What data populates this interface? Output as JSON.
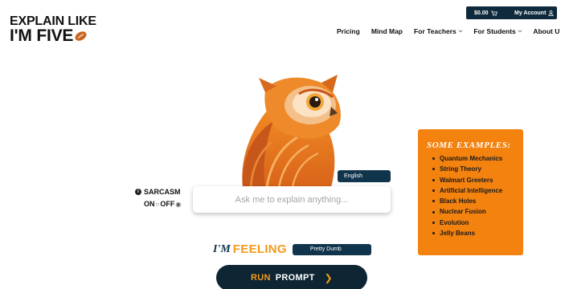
{
  "topbar": {
    "cart_amount": "$0.00",
    "account_label": "My Account"
  },
  "logo": {
    "line1": "EXPLAIN LIKE",
    "line2": "I'M FIVE"
  },
  "nav": {
    "pricing": "Pricing",
    "mind_map": "Mind Map",
    "for_teachers": "For Teachers",
    "for_students": "For Students",
    "about": "About U"
  },
  "language": {
    "selected": "English"
  },
  "sarcasm": {
    "label": "SARCASM",
    "on": "ON",
    "off": "OFF"
  },
  "ask": {
    "placeholder": "Ask me to explain anything..."
  },
  "feeling": {
    "im": "I'M",
    "feeling": "FEELING",
    "selected": "Pretty Dumb"
  },
  "run": {
    "part1": "RUN",
    "part2": "PROMPT"
  },
  "examples": {
    "title": "SOME EXAMPLES:",
    "items": [
      "Quantum Mechanics",
      "String Theory",
      "Walmart Greeters",
      "Artificial Intelligence",
      "Black Holes",
      "Nuclear Fusion",
      "Evolution",
      "Jelly Beans"
    ]
  },
  "colors": {
    "navy": "#10344c",
    "orange": "#f4820f",
    "accent": "#f39a1c"
  }
}
